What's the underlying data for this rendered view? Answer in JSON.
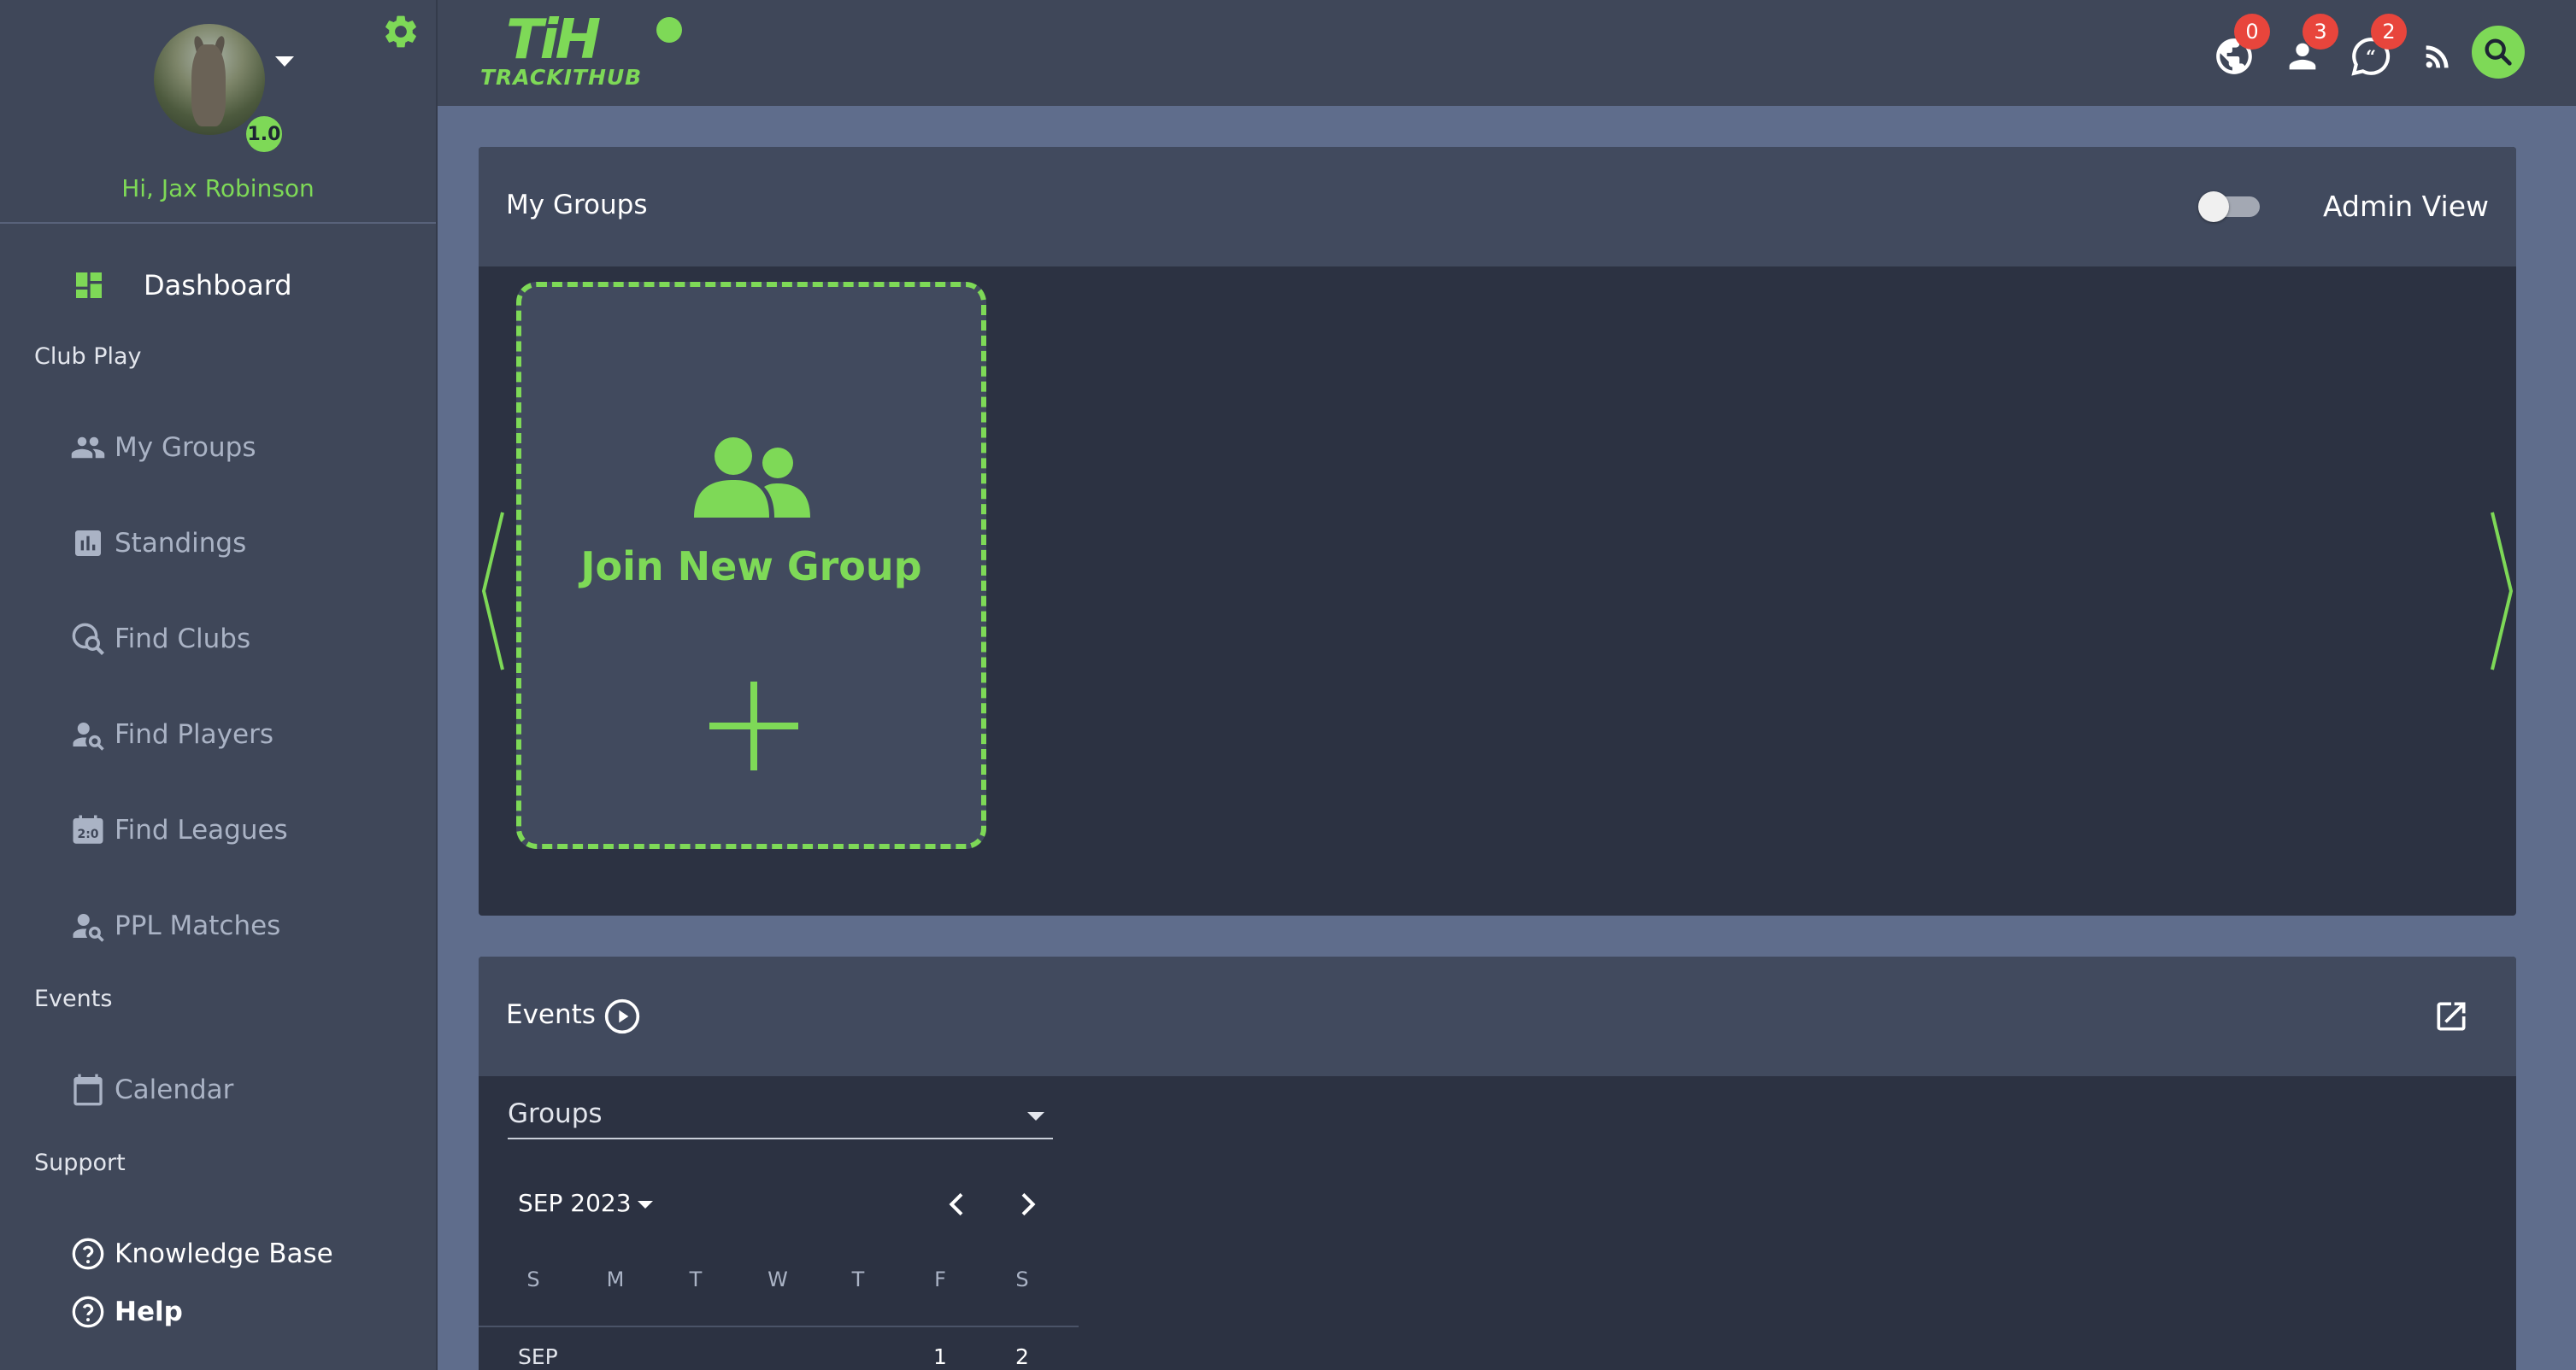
{
  "user": {
    "greeting": "Hi, Jax Robinson",
    "rating": "1.0"
  },
  "sidebar": {
    "dashboard_label": "Dashboard",
    "sections": {
      "club_play": "Club Play",
      "events": "Events",
      "support": "Support"
    },
    "club_play_items": [
      {
        "label": "My Groups",
        "icon": "groups-icon"
      },
      {
        "label": "Standings",
        "icon": "standings-icon"
      },
      {
        "label": "Find Clubs",
        "icon": "find-clubs-icon"
      },
      {
        "label": "Find Players",
        "icon": "find-players-icon"
      },
      {
        "label": "Find Leagues",
        "icon": "find-leagues-icon"
      },
      {
        "label": "PPL Matches",
        "icon": "ppl-matches-icon"
      }
    ],
    "events_items": [
      {
        "label": "Calendar",
        "icon": "calendar-icon"
      }
    ],
    "support_items": [
      {
        "label": "Knowledge Base",
        "icon": "help-circle-icon"
      },
      {
        "label": "Help",
        "icon": "help-circle-icon"
      }
    ]
  },
  "topbar": {
    "logo_mark": "TiH",
    "logo_word": "TRACKITHUB",
    "notifications": [
      {
        "icon": "globe-icon",
        "count": "0"
      },
      {
        "icon": "person-icon",
        "count": "3"
      },
      {
        "icon": "chat-icon",
        "count": "2"
      }
    ]
  },
  "groups_card": {
    "title": "My Groups",
    "admin_view_label": "Admin View",
    "admin_view_on": false,
    "join_label": "Join New Group"
  },
  "events_card": {
    "title": "Events",
    "group_select": "Groups",
    "month": "SEP 2023",
    "weekdays": [
      "S",
      "M",
      "T",
      "W",
      "T",
      "F",
      "S"
    ],
    "row_label": "SEP",
    "days": [
      "1",
      "2"
    ]
  },
  "colors": {
    "accent": "#7ed957",
    "sidebar_bg": "#3f4759",
    "page_bg": "#5f6d8c",
    "card_bg": "#2c3242",
    "card_header_bg": "#414a5e",
    "badge": "#e8453c"
  }
}
